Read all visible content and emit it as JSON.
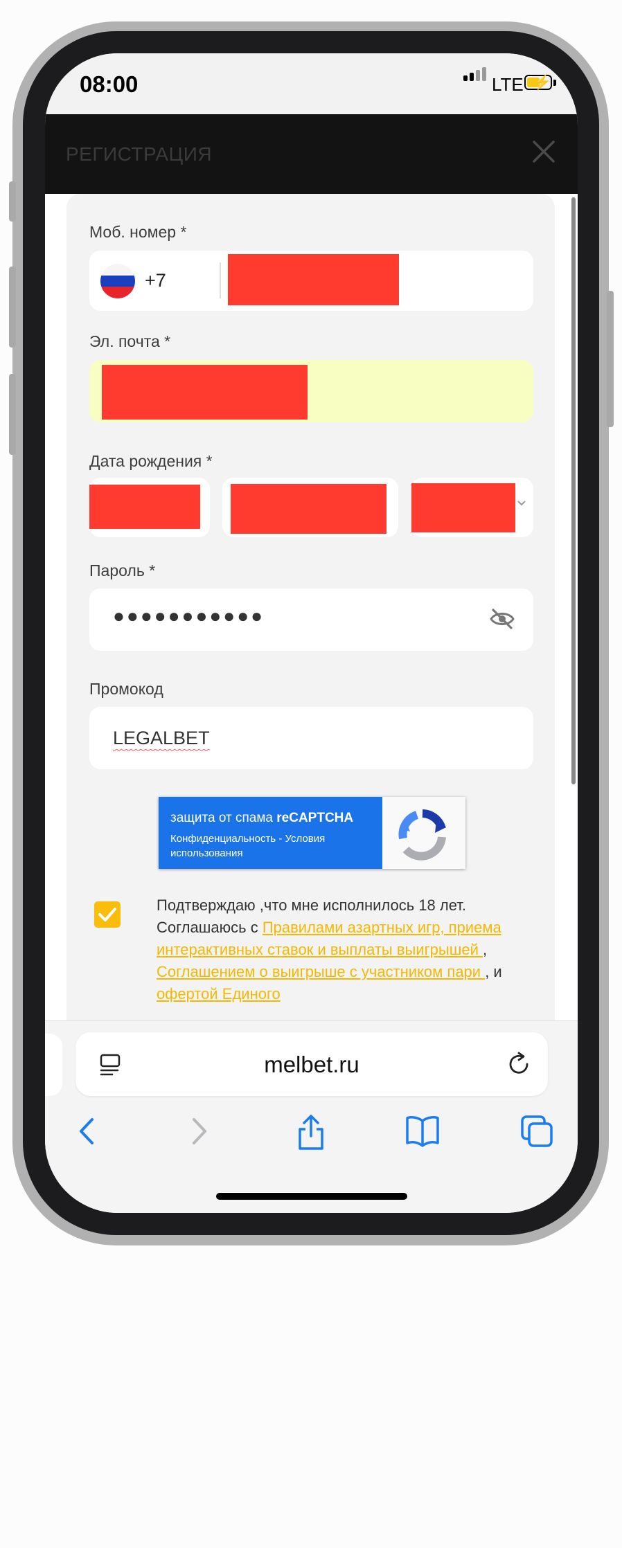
{
  "status_bar": {
    "time": "08:00",
    "network": "LTE"
  },
  "header": {
    "title": "РЕГИСТРАЦИЯ",
    "close_icon": "close-icon"
  },
  "form": {
    "phone_label": "Моб. номер *",
    "country_code": "+7",
    "country_flag": "russia-flag-icon",
    "email_label": "Эл. почта *",
    "birth_label": "Дата рождения *",
    "password_label": "Пароль *",
    "password_value": "●●●●●●●●●●●",
    "promo_label": "Промокод",
    "promo_value": "LEGALBET"
  },
  "recaptcha": {
    "prefix": "защита от спама ",
    "brand": "reCAPTCHA",
    "privacy": "Конфиденциальность",
    "separator": " - ",
    "terms": "Условия использования"
  },
  "consent": {
    "checked": true,
    "text_1": "Подтверждаю ,что мне исполнилось 18 лет. Соглашаюсь с ",
    "link_rules": "Правилами азартных игр, приема интерактивных ставок и выплаты выигрышей ",
    "text_2": ", ",
    "link_agreement": "Соглашением о выигрыше с участником пари ",
    "text_3": ", и ",
    "link_offer": "офертой Единого"
  },
  "browser": {
    "url": "melbet.ru",
    "toolbar": [
      "back-icon",
      "forward-icon",
      "share-icon",
      "bookmarks-icon",
      "tabs-icon"
    ]
  },
  "colors": {
    "accent": "#fbbd0c",
    "header_bg": "#131313",
    "ios_blue": "#1a7cf0",
    "recaptcha_blue": "#1a73e8",
    "redaction": "#ff3b30",
    "autofill": "#f8fdc2"
  }
}
